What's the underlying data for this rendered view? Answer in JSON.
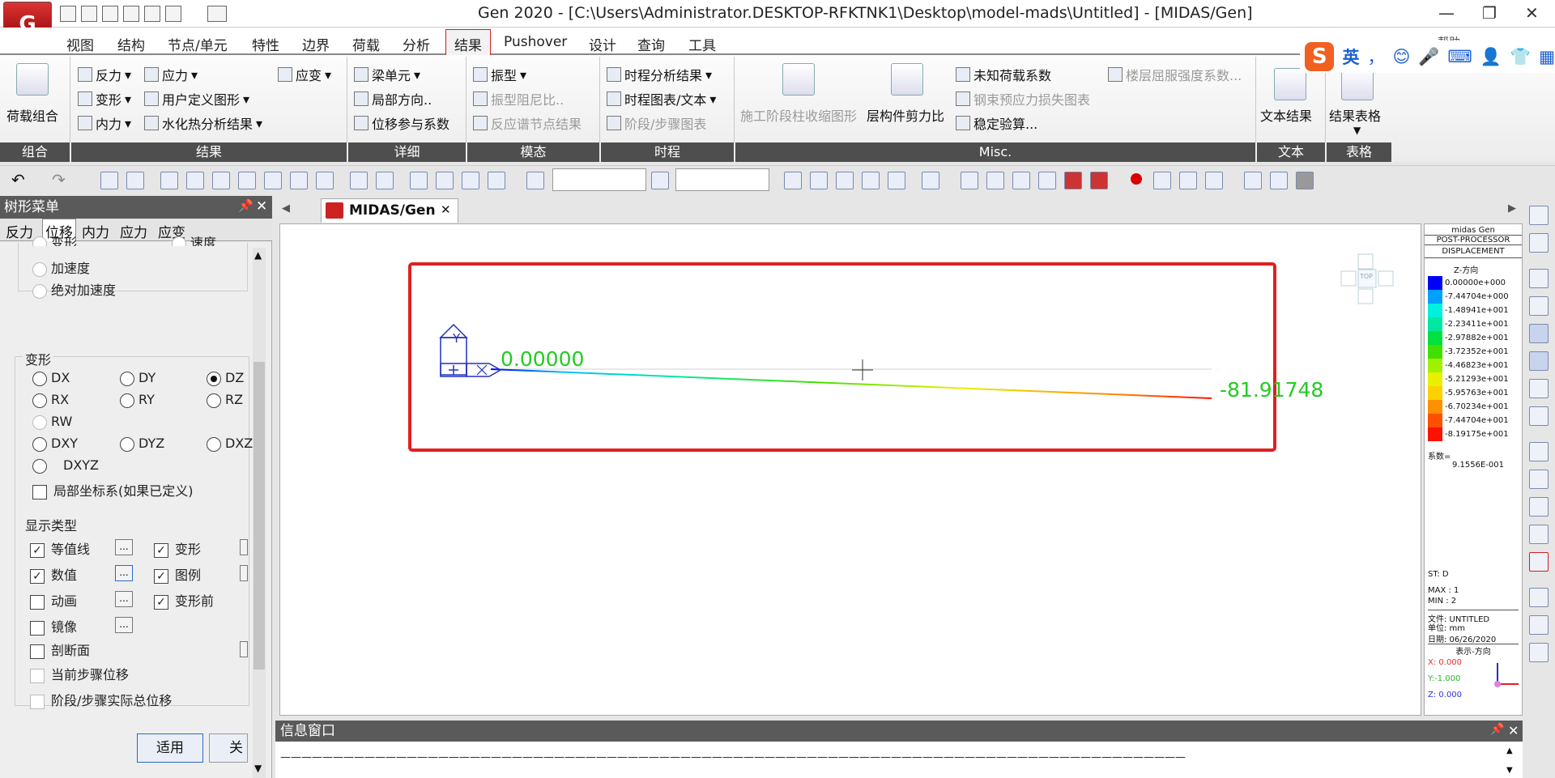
{
  "app": {
    "logo_text": "G",
    "title": "Gen 2020 - [C:\\Users\\Administrator.DESKTOP-RFKTNK1\\Desktop\\model-mads\\Untitled] - [MIDAS/Gen]",
    "minimize": "—",
    "restore": "❐",
    "close": "✕"
  },
  "menu": [
    "视图",
    "结构",
    "节点/单元",
    "特性",
    "边界",
    "荷载",
    "分析",
    "结果",
    "Pushover",
    "设计",
    "查询",
    "工具"
  ],
  "menu_active_index": 7,
  "help": "帮助",
  "ime": {
    "logo": "S",
    "lang": "英",
    "punct": "，",
    "icons": [
      "😊",
      "🎤",
      "⌨",
      "👤",
      "👕",
      "▦"
    ]
  },
  "ribbon": {
    "load_combo": "荷载组合",
    "results_col1": [
      "反力",
      "变形",
      "内力"
    ],
    "results_col2": [
      "应力",
      "用户定义图形",
      "水化热分析结果"
    ],
    "results_col3": [
      "应变"
    ],
    "detail": [
      "梁单元",
      "局部方向..",
      "位移参与系数"
    ],
    "mode": [
      "振型",
      "振型阻尼比..",
      "反应谱节点结果"
    ],
    "history": [
      "时程分析结果",
      "时程图表/文本",
      "阶段/步骤图表"
    ],
    "misc_big1": "施工阶段柱收缩图形",
    "misc_big2": "层构件剪力比",
    "misc_col": [
      "未知荷载系数",
      "钢束预应力损失图表",
      "稳定验算..."
    ],
    "misc_extra": "楼层屈服强度系数...",
    "text_result": "文本结果",
    "table_result": "结果表格",
    "groups": [
      "组合",
      "结果",
      "详细",
      "模态",
      "时程",
      "Misc.",
      "文本",
      "表格"
    ]
  },
  "tree_panel": {
    "title": "树形菜单",
    "tabs": [
      "反力",
      "位移",
      "内力",
      "应力",
      "应变"
    ],
    "active_tab_index": 1,
    "top_radios": [
      "变形",
      "速度",
      "加速度",
      "绝对加速度"
    ],
    "deform_legend": "变形",
    "deform_options": [
      "DX",
      "DY",
      "DZ",
      "RX",
      "RY",
      "RZ",
      "RW",
      "DXY",
      "DYZ",
      "DXZ",
      "DXYZ"
    ],
    "deform_selected": "DZ",
    "local_cs": "局部坐标系(如果已定义)",
    "display_legend": "显示类型",
    "display_items": [
      {
        "label": "等值线",
        "checked": true
      },
      {
        "label": "变形",
        "checked": true
      },
      {
        "label": "数值",
        "checked": true
      },
      {
        "label": "图例",
        "checked": true
      },
      {
        "label": "动画",
        "checked": false
      },
      {
        "label": "变形前",
        "checked": true
      },
      {
        "label": "镜像",
        "checked": false
      },
      {
        "label": "剖断面",
        "checked": false
      }
    ],
    "current_step": "当前步骤位移",
    "stage_total": "阶段/步骤实际总位移",
    "apply": "适用",
    "close": "关闭",
    "dots": "..."
  },
  "doc_tab": {
    "label": "MIDAS/Gen",
    "close": "✕"
  },
  "canvas": {
    "axis_y": "Y",
    "value_left": "0.00000",
    "value_right": "-81.91748",
    "view_cube": "TOP"
  },
  "legend": {
    "title1": "midas Gen",
    "title2": "POST-PROCESSOR",
    "title3": "DISPLACEMENT",
    "direction": "Z-方向",
    "entries": [
      {
        "value": "0.00000e+000",
        "color": "#0000ff"
      },
      {
        "value": "-7.44704e+000",
        "color": "#00a0ff"
      },
      {
        "value": "-1.48941e+001",
        "color": "#00f0e0"
      },
      {
        "value": "-2.23411e+001",
        "color": "#00e8a0"
      },
      {
        "value": "-2.97882e+001",
        "color": "#00e040"
      },
      {
        "value": "-3.72352e+001",
        "color": "#40e000"
      },
      {
        "value": "-4.46823e+001",
        "color": "#a0f000"
      },
      {
        "value": "-5.21293e+001",
        "color": "#e8f000"
      },
      {
        "value": "-5.95763e+001",
        "color": "#ffd000"
      },
      {
        "value": "-6.70234e+001",
        "color": "#ff9000"
      },
      {
        "value": "-7.44704e+001",
        "color": "#ff5000"
      },
      {
        "value": "-8.19175e+001",
        "color": "#ff1000"
      }
    ],
    "factor_label": "系数=",
    "factor_value": "9.1556E-001",
    "st": "ST: D",
    "max": "MAX : 1",
    "min": "MIN : 2",
    "file": "文件: UNTITLED",
    "unit": "单位: mm",
    "date": "日期: 06/26/2020",
    "view_dir": "表示-方向",
    "x": "X: 0.000",
    "y": "Y:-1.000",
    "z": "Z: 0.000"
  },
  "message": {
    "title": "信息窗口",
    "line": "——————————————————————————————————————————————————————————————————————————————————————"
  },
  "colors": {
    "highlight": "#e02020",
    "value_text": "#22cc22",
    "menu_active": "#d02020"
  }
}
